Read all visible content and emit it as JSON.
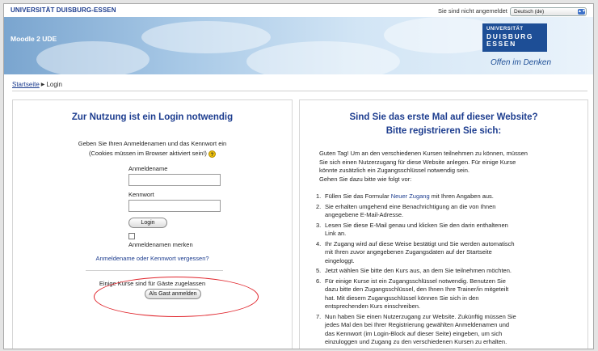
{
  "header": {
    "university": "UNIVERSITÄT DUISBURG-ESSEN",
    "login_status": "Sie sind nicht angemeldet",
    "language_selected": "Deutsch (de)"
  },
  "banner": {
    "site_title": "Moodle 2 UDE",
    "logo_line1": "UNIVERSITÄT",
    "logo_line2": "DUISBURG",
    "logo_line3": "ESSEN",
    "slogan": "Offen im Denken"
  },
  "breadcrumb": {
    "home": "Startseite",
    "current": "Login"
  },
  "login": {
    "heading": "Zur Nutzung ist ein Login notwendig",
    "info_line1": "Geben Sie Ihren Anmeldenamen und das Kennwort ein",
    "info_line2": "(Cookies müssen im Browser aktiviert sein!)",
    "help_icon": "?",
    "username_label": "Anmeldename",
    "username_value": "",
    "password_label": "Kennwort",
    "password_value": "",
    "login_button": "Login",
    "remember_label": "Anmeldenamen merken",
    "forgot_link": "Anmeldename oder Kennwort vergessen?",
    "guest_text": "Einige Kurse sind für Gäste zugelassen",
    "guest_button": "Als Gast anmelden"
  },
  "signup": {
    "heading_line1": "Sind Sie das erste Mal auf dieser Website?",
    "heading_line2": "Bitte registrieren Sie sich:",
    "intro_line1": "Guten Tag! Um an den verschiedenen Kursen teilnehmen zu können, müssen",
    "intro_line2": "Sie sich einen Nutzerzugang für diese Website anlegen. Für einige Kurse",
    "intro_line3": "könnte zusätzlich ein Zugangsschlüssel notwendig sein.",
    "intro_line4": "Gehen Sie dazu bitte wie folgt vor:",
    "step1_pre": "Füllen Sie das Formular ",
    "step1_link": "Neuer Zugang",
    "step1_post": " mit Ihren Angaben aus.",
    "step2_line1": "Sie erhalten umgehend eine Benachrichtigung an die von Ihnen",
    "step2_line2": "angegebene E-Mail-Adresse.",
    "step3_line1": "Lesen Sie diese E-Mail genau und klicken Sie den darin enthaltenen",
    "step3_line2": "Link an.",
    "step4_line1": "Ihr Zugang wird auf diese Weise bestätigt und Sie werden automatisch",
    "step4_line2": "mit Ihren zuvor angegebenen Zugangsdaten auf der Startseite",
    "step4_line3": "eingeloggt.",
    "step5": "Jetzt wählen Sie bitte den Kurs aus, an dem Sie teilnehmen möchten.",
    "step6_line1": "Für einige Kurse ist ein Zugangsschlüssel notwendig. Benutzen Sie",
    "step6_line2": "dazu bitte den Zugangsschlüssel, den Ihnen Ihre Trainer/in mitgeteilt",
    "step6_line3": "hat. Mit diesem Zugangsschlüssel können Sie sich in den",
    "step6_line4": "entsprechenden Kurs einschreiben.",
    "step7_line1": "Nun haben Sie einen Nutzerzugang zur Website. Zukünftig müssen Sie",
    "step7_line2": "jedes Mal den bei Ihrer Registrierung gewählten Anmeldenamen und",
    "step7_line3": "das Kennwort (im Login-Block auf dieser Seite) eingeben, um sich",
    "step7_line4": "einzuloggen und Zugang zu den verschiedenen Kursen zu erhalten.",
    "nums": [
      "1.",
      "2.",
      "3.",
      "4.",
      "5.",
      "6.",
      "7."
    ]
  }
}
